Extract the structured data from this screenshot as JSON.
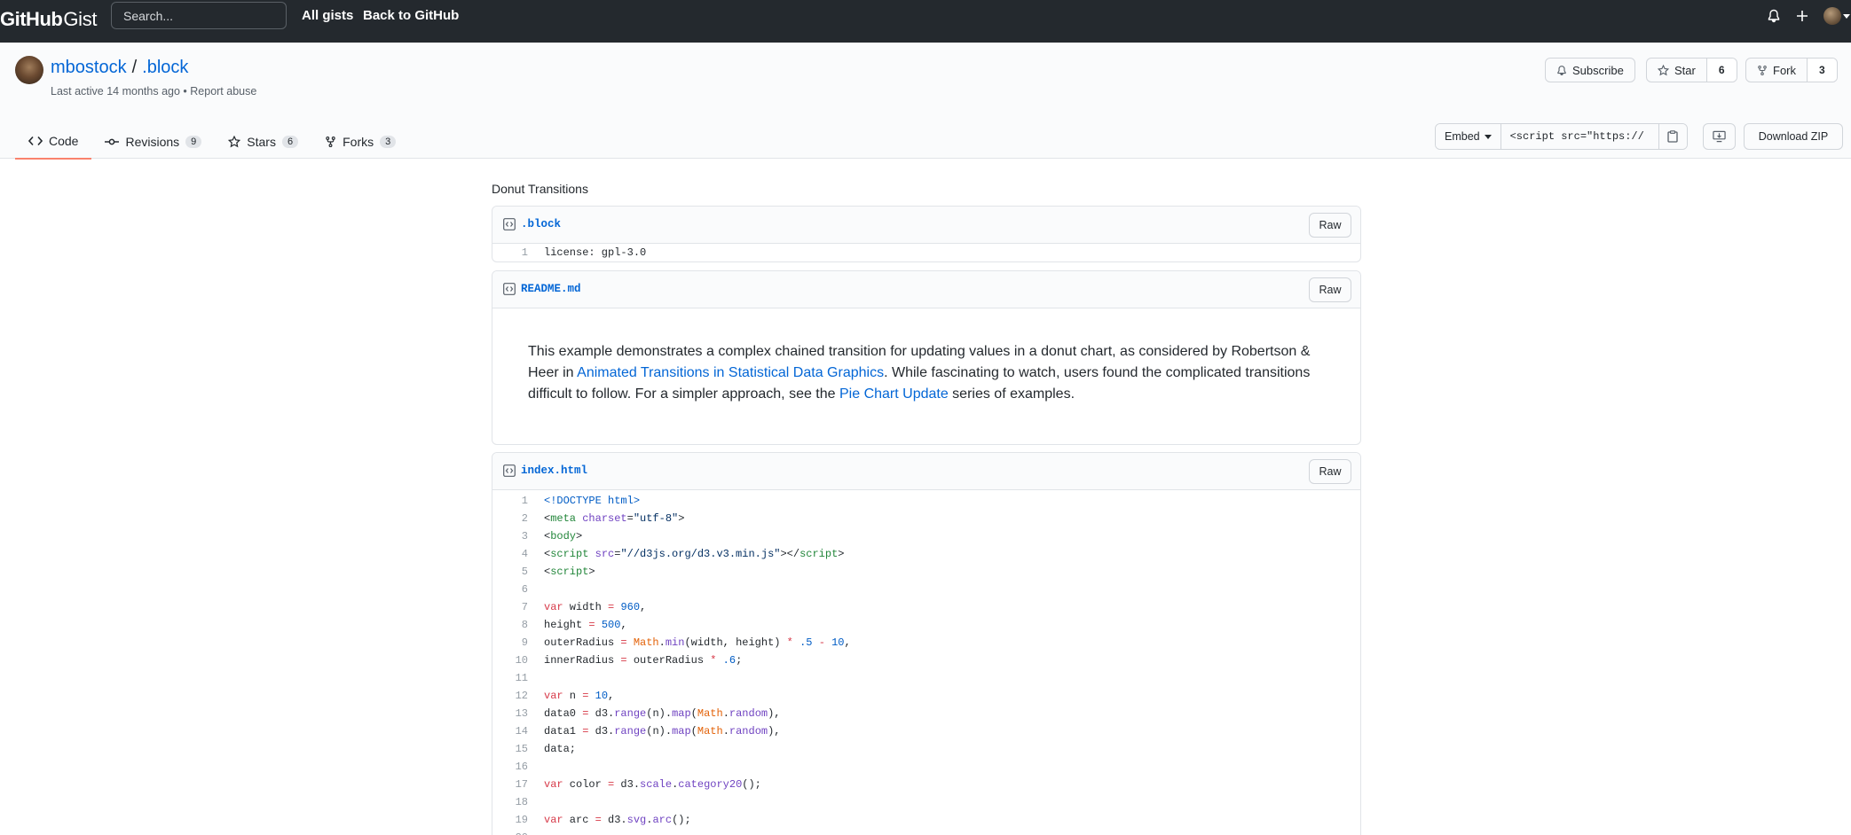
{
  "topbar": {
    "logo_github": "GitHub",
    "logo_gist": "Gist",
    "search_placeholder": "Search...",
    "all_gists": "All gists",
    "back_to_github": "Back to GitHub"
  },
  "gist": {
    "owner": "mbostock",
    "separator": "/",
    "name": ".block",
    "last_active": "Last active 14 months ago",
    "bullet": " • ",
    "report": "Report abuse",
    "subscribe": "Subscribe",
    "star": "Star",
    "star_count": "6",
    "fork": "Fork",
    "fork_count": "3"
  },
  "tabs": [
    {
      "label": "Code"
    },
    {
      "label": "Revisions",
      "count": "9"
    },
    {
      "label": "Stars",
      "count": "6"
    },
    {
      "label": "Forks",
      "count": "3"
    }
  ],
  "embed": {
    "label": "Embed",
    "value": "<script src=\"https://",
    "download": "Download ZIP"
  },
  "description": "Donut Transitions",
  "files": {
    "block": {
      "name": ".block",
      "raw": "Raw",
      "line_number": "1",
      "line": "license: gpl-3.0"
    },
    "readme": {
      "name": "README.md",
      "raw": "Raw",
      "text1": "This example demonstrates a complex chained transition for updating values in a donut chart, as considered by Robertson & Heer in ",
      "link1": "Animated Transitions in Statistical Data Graphics",
      "text2": ". While fascinating to watch, users found the complicated transitions difficult to follow. For a simpler approach, see the ",
      "link2": "Pie Chart Update",
      "text3": " series of examples."
    },
    "index": {
      "name": "index.html",
      "raw": "Raw"
    }
  },
  "colors": {
    "topbar_bg": "#24292e",
    "link": "#0366d6",
    "active_tab_border": "#f9826c",
    "keyword": "#d73a49",
    "number": "#005cc5",
    "tag": "#22863a"
  }
}
